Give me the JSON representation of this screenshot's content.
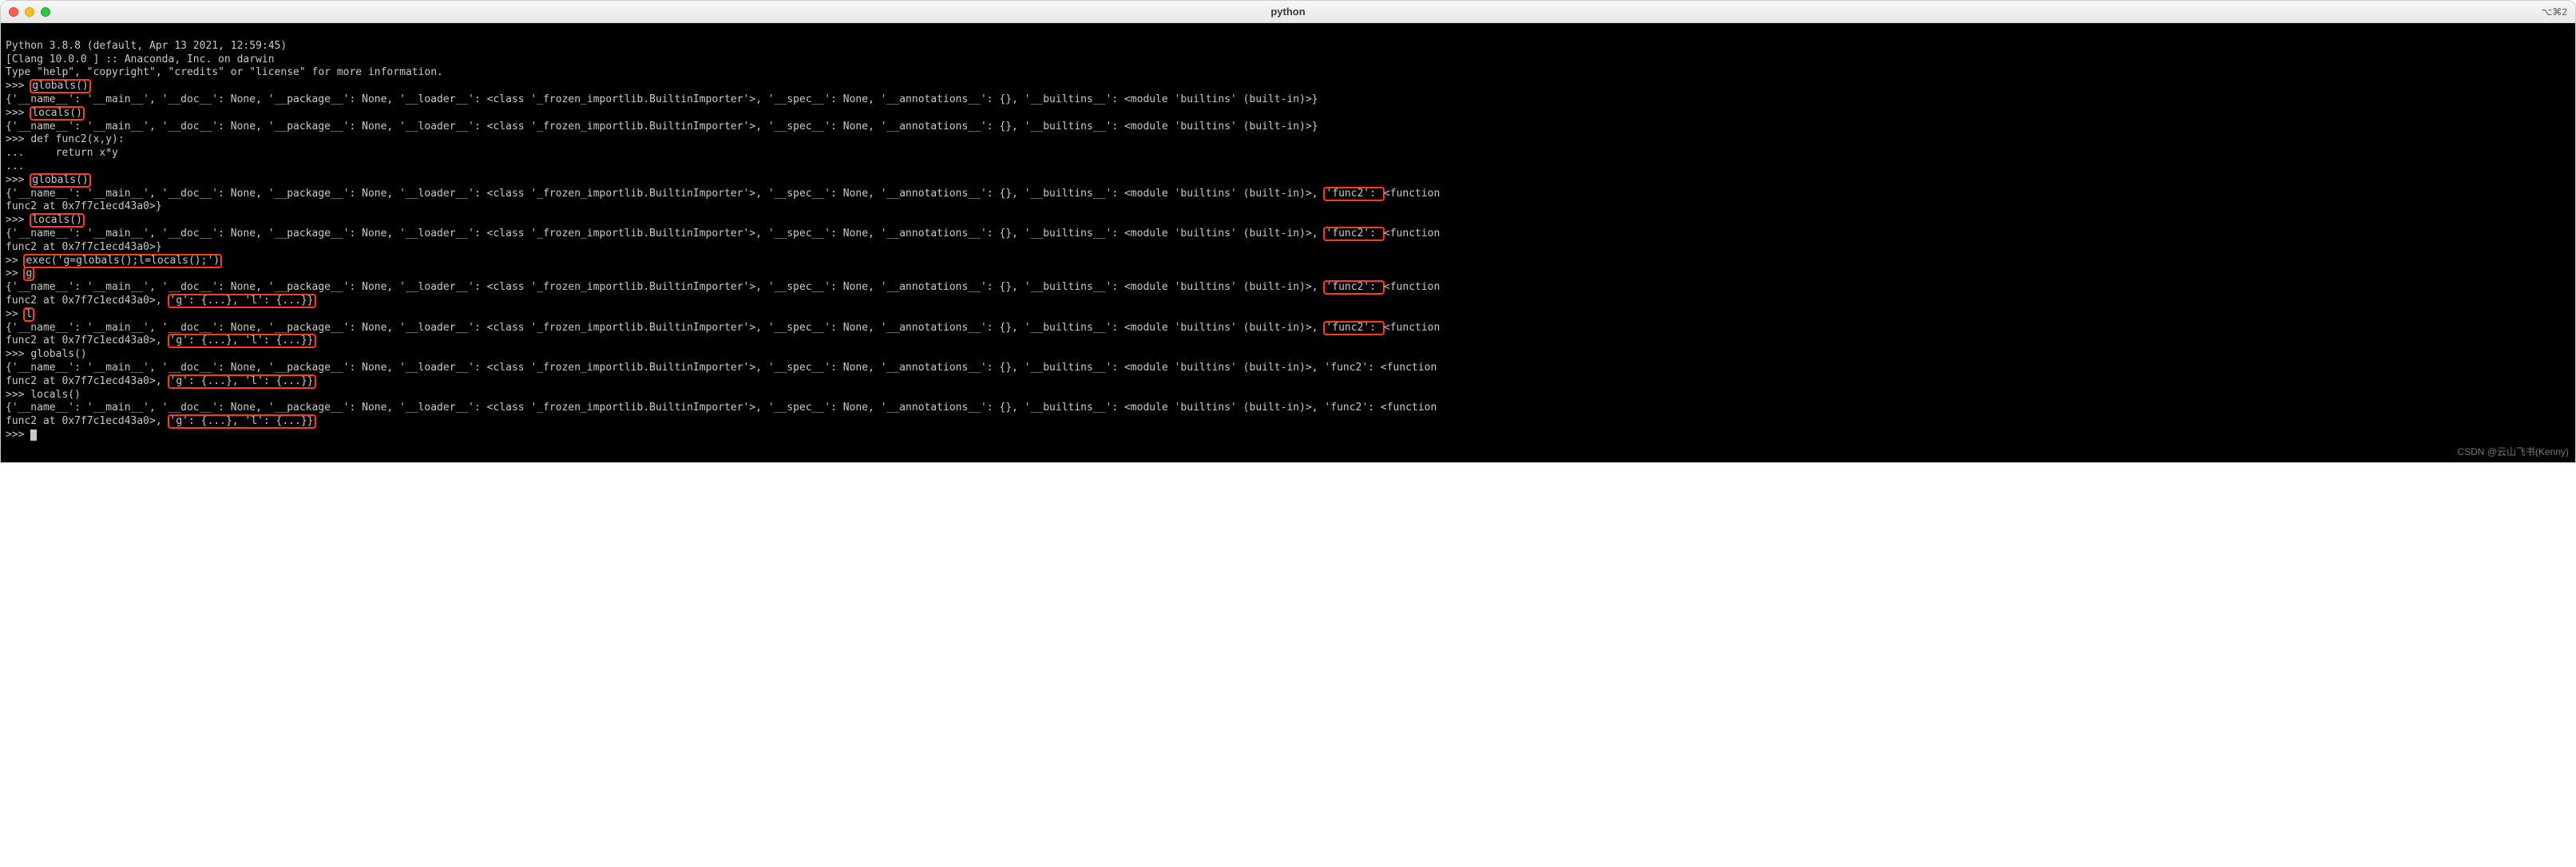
{
  "window": {
    "title": "python",
    "shortcut": "⌥⌘2"
  },
  "banner": {
    "line1": "Python 3.8.8 (default, Apr 13 2021, 12:59:45) ",
    "line2": "[Clang 10.0.0 ] :: Anaconda, Inc. on darwin",
    "line3": "Type \"help\", \"copyright\", \"credits\" or \"license\" for more information."
  },
  "prompts": {
    "p": ">>> ",
    "c": "... ",
    "p2": ">> "
  },
  "cmds": {
    "globals": "globals()",
    "locals": "locals()",
    "def": "def func2(x,y):",
    "body": "    return x*y",
    "empty": "",
    "exec": "exec('g=globals();l=locals();')",
    "g": "g",
    "l": "l"
  },
  "out": {
    "base1": "{'__name__': '__main__', '__doc__': None, '__package__': None, '__loader__': <class '_frozen_importlib.BuiltinImporter'>, '__spec__': None, '__annotations__': {}, '__builtins__': <module 'builtins' (built-in)>}",
    "func_pre": "{'__name__': '__main__', '__doc__': None, '__package__': None, '__loader__': <class '_frozen_importlib.BuiltinImporter'>, '__spec__': None, '__annotations__': {}, '__builtins__': <module 'builtins' (built-in)>, ",
    "func_key": "'func2': ",
    "func_tail": "<function ",
    "func_line2": "func2 at 0x7f7c1ecd43a0>}",
    "gl_line2pre": "func2 at 0x7f7c1ecd43a0>, ",
    "gl_dict": "'g': {...}, 'l': {...}}",
    "full_nohl": "{'__name__': '__main__', '__doc__': None, '__package__': None, '__loader__': <class '_frozen_importlib.BuiltinImporter'>, '__spec__': None, '__annotations__': {}, '__builtins__': <module 'builtins' (built-in)>, 'func2': <function "
  },
  "watermark": "CSDN @云山飞书(Kenny)"
}
